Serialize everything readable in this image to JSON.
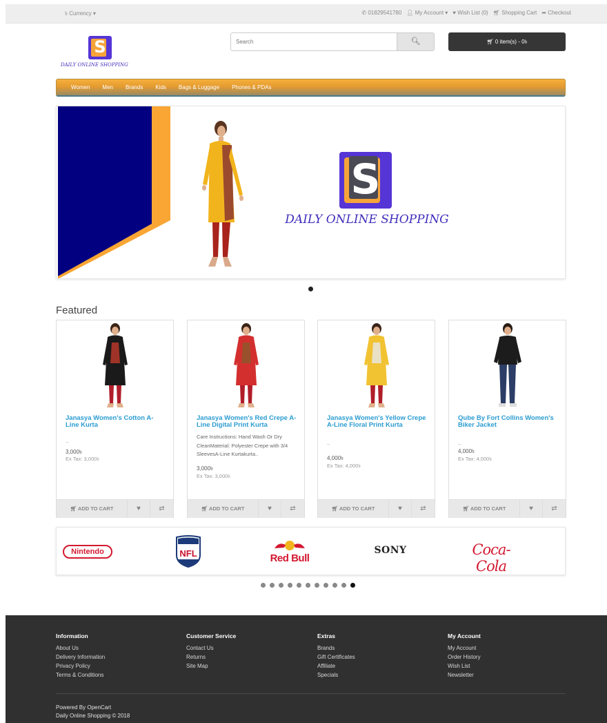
{
  "topbar": {
    "currency_label": "৳ Currency ▾",
    "phone": "01829541780",
    "my_account": "My Account ▾",
    "wish_list": "Wish List (0)",
    "shopping_cart": "Shopping Cart",
    "checkout": "Checkout"
  },
  "header": {
    "logo_letter": "S",
    "logo_text": "DAILY ONLINE SHOPPING",
    "search_placeholder": "Search",
    "search_icon": "search-icon",
    "cart_label": "0 item(s) - 0৳"
  },
  "menu": {
    "items": [
      "Women",
      "Men",
      "Brands",
      "Kids",
      "Bags & Luggage",
      "Phones & PDAs"
    ]
  },
  "slideshow": {
    "logo_letter": "S",
    "title": "DAILY ONLINE SHOPPING",
    "colors": {
      "navy": "#020080",
      "orange": "#f9a634",
      "purple": "#5535d6"
    }
  },
  "featured": {
    "heading": "Featured",
    "products": [
      {
        "name": "Janasya Women's Cotton A-Line Kurta",
        "desc": "..",
        "price": "3,000৳",
        "ex_tax": "Ex Tax: 3,000৳",
        "dress_color": "#1a1a1a",
        "accent": "#c0392b"
      },
      {
        "name": "Janasya Women's Red Crepe A-Line Digital Print Kurta",
        "desc": "Care Instructions: Hand Wash Or Dry CleanMaterial: Polyester Crepe with 3/4 SleevesA-Line Kurtakurta..",
        "price": "3,000৳",
        "ex_tax": "Ex Tax: 3,000৳",
        "dress_color": "#d32f2f",
        "accent": "#8b5a2b"
      },
      {
        "name": "Janasya Women's Yellow Crepe A-Line Floral Print Kurta",
        "desc": "..",
        "price": "4,000৳",
        "ex_tax": "Ex Tax: 4,000৳",
        "dress_color": "#f1c232",
        "accent": "#e8e8e8"
      },
      {
        "name": "Qube By Fort Collins Women's Biker Jacket",
        "desc": "..",
        "price": "4,000৳",
        "ex_tax": "Ex Tax: 4,000৳",
        "dress_color": "#1c1c1c",
        "accent": "#2c3e66"
      }
    ],
    "add_to_cart": "ADD TO CART"
  },
  "brands": {
    "logos": [
      "Nintendo",
      "NFL",
      "Red Bull",
      "SONY",
      "Coca-Cola"
    ],
    "pager_count": 11,
    "pager_active": 11
  },
  "footer": {
    "columns": [
      {
        "title": "Information",
        "links": [
          "About Us",
          "Delivery Information",
          "Privacy Policy",
          "Terms & Conditions"
        ]
      },
      {
        "title": "Customer Service",
        "links": [
          "Contact Us",
          "Returns",
          "Site Map"
        ]
      },
      {
        "title": "Extras",
        "links": [
          "Brands",
          "Gift Certificates",
          "Affiliate",
          "Specials"
        ]
      },
      {
        "title": "My Account",
        "links": [
          "My Account",
          "Order History",
          "Wish List",
          "Newsletter"
        ]
      }
    ],
    "powered_by": "Powered By OpenCart",
    "copyright": "Daily Online Shopping © 2018"
  }
}
